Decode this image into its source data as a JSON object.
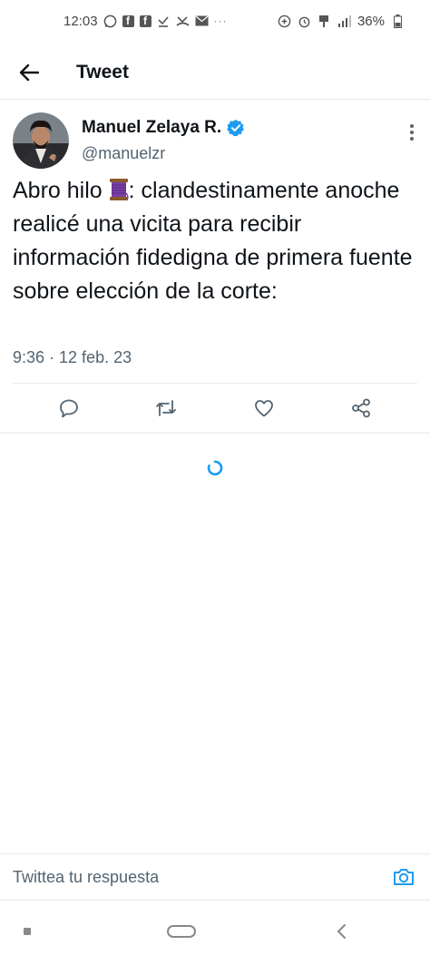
{
  "status_bar": {
    "time": "12:03",
    "battery": "36%",
    "notification_icons": [
      "whatsapp-icon",
      "facebook-icon",
      "facebook-icon",
      "download-check-icon",
      "missed-call-icon",
      "mail-icon",
      "more-dots-icon"
    ],
    "system_icons": [
      "data-saver-icon",
      "alarm-icon",
      "vpn-key-icon",
      "signal-icon",
      "battery-icon"
    ]
  },
  "header": {
    "title": "Tweet"
  },
  "tweet": {
    "author_name": "Manuel Zelaya R.",
    "author_handle": "@manuelzr",
    "verified": true,
    "text_before_emoji": "Abro hilo ",
    "emoji": "🧵",
    "text_after_emoji": ": clandestinamente anoche realicé una vicita para recibir información fidedigna de primera fuente sobre elección de la corte:",
    "timestamp": "9:36 · 12 feb. 23"
  },
  "actions": [
    "reply-icon",
    "retweet-icon",
    "like-icon",
    "share-icon"
  ],
  "reply_bar": {
    "placeholder": "Twittea tu respuesta"
  },
  "colors": {
    "accent": "#1d9bf0",
    "text": "#0f1419",
    "secondary_text": "#536471",
    "divider": "#e6e9eb"
  }
}
